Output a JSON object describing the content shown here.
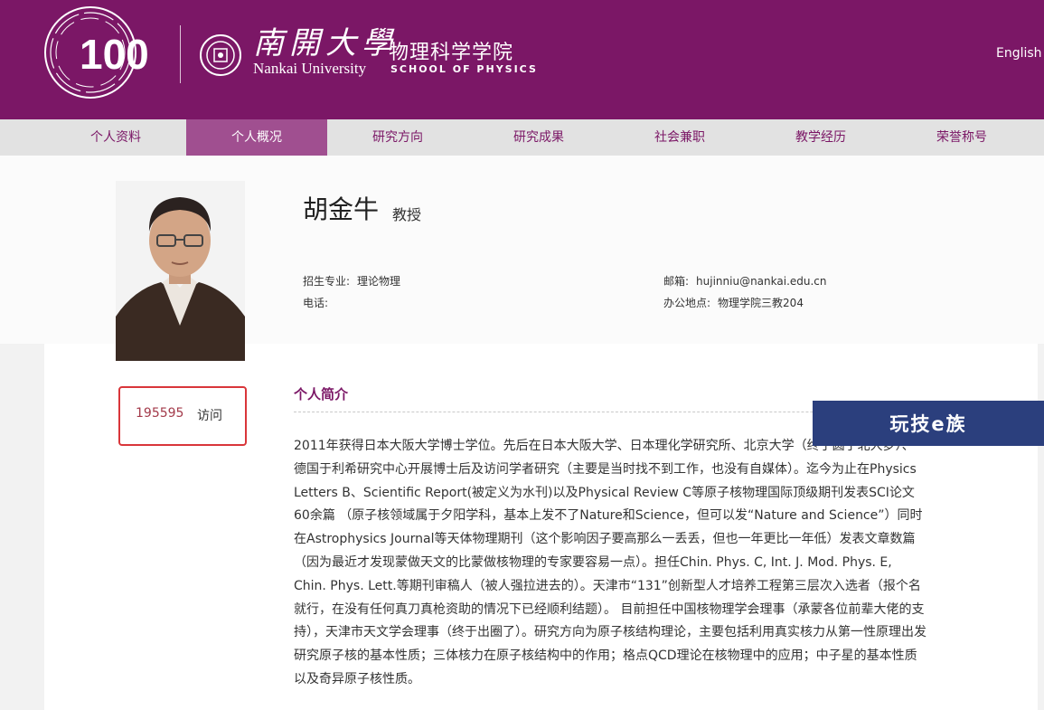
{
  "header": {
    "logo_100": "100",
    "university_cn": "南開大學",
    "university_en": "Nankai University",
    "school_cn": "物理科学学院",
    "school_en": "SCHOOL OF PHYSICS",
    "lang_link": "English",
    "accent_color": "#7b1766"
  },
  "nav": {
    "items": [
      "个人资料",
      "个人概况",
      "研究方向",
      "研究成果",
      "社会兼职",
      "教学经历",
      "荣誉称号"
    ],
    "active_index": 1
  },
  "profile": {
    "name": "胡金牛",
    "title": "教授",
    "major_label": "招生专业:",
    "major_value": "理论物理",
    "phone_label": "电话:",
    "phone_value": "",
    "email_label": "邮箱:",
    "email_value": "hujinniu@nankai.edu.cn",
    "office_label": "办公地点:",
    "office_value": "物理学院三教204"
  },
  "visits": {
    "count": "195595",
    "label": "访问"
  },
  "bio": {
    "section_title": "个人简介",
    "text": "2011年获得日本大阪大学博士学位。先后在日本大阪大学、日本理化学研究所、北京大学（终于圆了北大梦）、德国于利希研究中心开展博士后及访问学者研究（主要是当时找不到工作，也没有自媒体）。迄今为止在Physics Letters B、Scientific Report(被定义为水刊)以及Physical Review C等原子核物理国际顶级期刊发表SCI论文60余篇 （原子核领域属于夕阳学科，基本上发不了Nature和Science，但可以发“Nature and Science”）同时在Astrophysics Journal等天体物理期刊（这个影响因子要高那么一丢丢，但也一年更比一年低）发表文章数篇（因为最近才发现蒙做天文的比蒙做核物理的专家要容易一点）。担任Chin. Phys. C, Int. J. Mod. Phys. E, Chin. Phys. Lett.等期刊审稿人（被人强拉进去的）。天津市“131”创新型人才培养工程第三层次入选者（报个名就行，在没有任何真刀真枪资助的情况下已经顺利结题）。 目前担任中国核物理学会理事（承蒙各位前辈大佬的支持），天津市天文学会理事（终于出圈了）。研究方向为原子核结构理论，主要包括利用真实核力从第一性原理出发研究原子核的基本性质；三体核力在原子核结构中的作用；格点QCD理论在核物理中的应用；中子星的基本性质以及奇异原子核性质。"
  },
  "watermark": {
    "text": "玩技e族"
  }
}
